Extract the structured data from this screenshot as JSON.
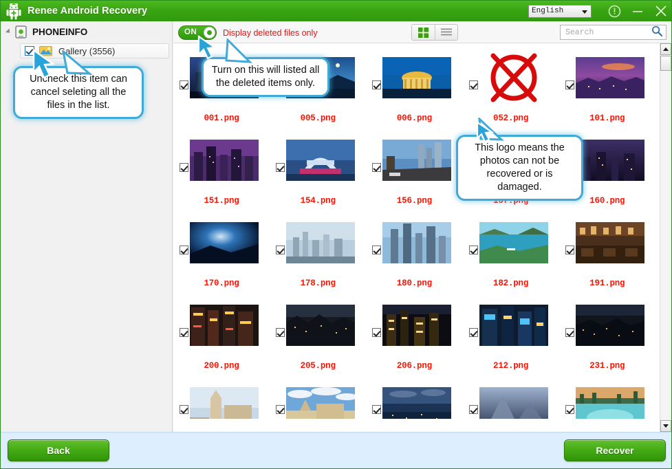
{
  "window": {
    "title": "Renee Android Recovery",
    "logo_icon": "android-robot-nurse-icon",
    "language": "English",
    "language_caret_icon": "chevron-down-icon",
    "help_icon": "help-circle-icon",
    "minimize_icon": "minimize-icon",
    "close_icon": "close-icon",
    "accent_green": "#39a312",
    "alert_red": "#ee1111",
    "callout_blue": "#3fa9d8",
    "footer_blue": "#ddeeff"
  },
  "sidebar": {
    "root": {
      "label": "PHONEINFO",
      "icon": "android-phone-icon",
      "expander_icon": "tree-expander-icon"
    },
    "child": {
      "label": "Gallery (3556)",
      "icon": "gallery-folder-icon",
      "checked": true
    }
  },
  "toolbar": {
    "toggle": {
      "state_label": "ON",
      "on": true,
      "description": "Display deleted files only"
    },
    "view_modes": [
      {
        "name": "grid-view",
        "icon": "grid-view-icon",
        "active": true
      },
      {
        "name": "list-view",
        "icon": "list-view-icon",
        "active": false
      }
    ],
    "search": {
      "value": "",
      "placeholder": "Search",
      "icon": "search-icon"
    }
  },
  "grid": {
    "rows": [
      [
        {
          "name": "001.png",
          "checked": true,
          "damaged": false,
          "kind": "city-night-skyline"
        },
        {
          "name": "005.png",
          "checked": true,
          "damaged": false,
          "kind": "coast-blue-sea"
        },
        {
          "name": "006.png",
          "checked": true,
          "damaged": false,
          "kind": "golden-dome-monument"
        },
        {
          "name": "052.png",
          "checked": true,
          "damaged": true,
          "kind": "not-recoverable"
        },
        {
          "name": "101.png",
          "checked": true,
          "damaged": false,
          "kind": "purple-sunset-city"
        }
      ],
      [
        {
          "name": "151.png",
          "checked": true,
          "damaged": false,
          "kind": "purple-skyscrapers"
        },
        {
          "name": "154.png",
          "checked": true,
          "damaged": false,
          "kind": "white-arch-stadium"
        },
        {
          "name": "156.png",
          "checked": true,
          "damaged": false,
          "kind": "daylight-downtown"
        },
        {
          "name": "157.png",
          "checked": true,
          "damaged": false,
          "kind": "dark-night-street"
        },
        {
          "name": "160.png",
          "checked": true,
          "damaged": false,
          "kind": "dusk-city-lights"
        }
      ],
      [
        {
          "name": "170.png",
          "checked": true,
          "damaged": false,
          "kind": "deep-blue-sun-flare"
        },
        {
          "name": "178.png",
          "checked": true,
          "damaged": false,
          "kind": "foggy-harbor-city"
        },
        {
          "name": "180.png",
          "checked": true,
          "damaged": false,
          "kind": "tall-towers-sky"
        },
        {
          "name": "182.png",
          "checked": true,
          "damaged": false,
          "kind": "green-lake-island"
        },
        {
          "name": "191.png",
          "checked": true,
          "damaged": false,
          "kind": "warm-interior-hall"
        }
      ],
      [
        {
          "name": "200.png",
          "checked": true,
          "damaged": false,
          "kind": "neon-street-signs"
        },
        {
          "name": "205.png",
          "checked": true,
          "damaged": false,
          "kind": "dark-town-dusk"
        },
        {
          "name": "206.png",
          "checked": true,
          "damaged": false,
          "kind": "golden-city-night"
        },
        {
          "name": "212.png",
          "checked": true,
          "damaged": false,
          "kind": "blue-billboard-street"
        },
        {
          "name": "231.png",
          "checked": true,
          "damaged": false,
          "kind": "dark-night-panorama"
        }
      ],
      [
        {
          "name": "",
          "checked": true,
          "damaged": false,
          "kind": "cathedral-spire"
        },
        {
          "name": "",
          "checked": true,
          "damaged": false,
          "kind": "parliament-clouds"
        },
        {
          "name": "",
          "checked": true,
          "damaged": false,
          "kind": "river-city-twilight"
        },
        {
          "name": "",
          "checked": true,
          "damaged": false,
          "kind": "misty-mountain"
        },
        {
          "name": "",
          "checked": true,
          "damaged": false,
          "kind": "turquoise-pool-lake"
        }
      ]
    ]
  },
  "scrollbar": {
    "up_icon": "scroll-up-icon",
    "down_icon": "scroll-down-icon"
  },
  "footer": {
    "back_label": "Back",
    "recover_label": "Recover"
  },
  "callouts": [
    {
      "id": "callout-1",
      "text": "Uncheck this item can cancel seleting all the files in the list."
    },
    {
      "id": "callout-2",
      "text": "Turn on this will listed all the deleted items only."
    },
    {
      "id": "callout-3",
      "text": "This logo means the photos can not be recovered or is damaged."
    }
  ]
}
